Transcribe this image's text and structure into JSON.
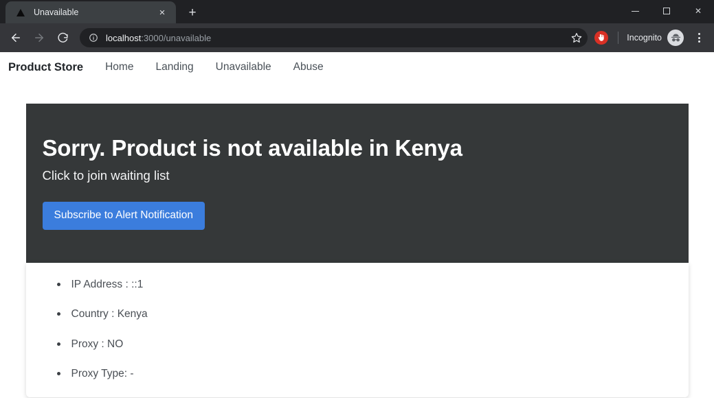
{
  "window": {
    "controls": {
      "minimize": "minimize-button",
      "maximize": "maximize-button",
      "close": "close-button"
    }
  },
  "browser": {
    "tab": {
      "title": "Unavailable",
      "favicon": "triangle-icon",
      "close_label": "×"
    },
    "new_tab_label": "+",
    "nav": {
      "back": "back-arrow-icon",
      "forward": "forward-arrow-icon",
      "reload": "reload-icon"
    },
    "omnibox": {
      "info_icon": "info-circle-icon",
      "host": "localhost",
      "path": ":3000/unavailable",
      "full_url": "localhost:3000/unavailable"
    },
    "bookmark_icon": "star-icon",
    "extension_icon": "hand-stop-icon",
    "profile": {
      "label": "Incognito",
      "icon": "incognito-spy-icon"
    },
    "menu_icon": "kebab-menu-icon"
  },
  "page": {
    "navbar": {
      "brand": "Product Store",
      "links": [
        {
          "label": "Home"
        },
        {
          "label": "Landing"
        },
        {
          "label": "Unavailable"
        },
        {
          "label": "Abuse"
        }
      ]
    },
    "jumbotron": {
      "title": "Sorry. Product is not available in Kenya",
      "subtitle": "Click to join waiting list",
      "button_label": "Subscribe to Alert Notification",
      "background_color": "#353839",
      "button_color": "#3b7ddd"
    },
    "info": {
      "items": [
        {
          "label": "IP Address : ::1"
        },
        {
          "label": "Country : Kenya"
        },
        {
          "label": "Proxy : NO"
        },
        {
          "label": "Proxy Type: -"
        }
      ]
    }
  }
}
